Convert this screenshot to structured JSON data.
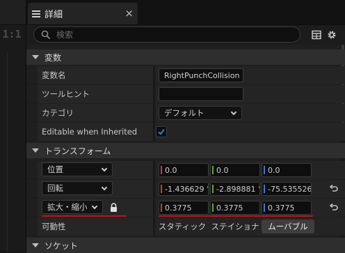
{
  "viewport": {
    "ratio_label": "1:1"
  },
  "tab": {
    "title": "詳細",
    "close": "×"
  },
  "search": {
    "placeholder": "検索"
  },
  "sections": {
    "variable": {
      "title": "変数"
    },
    "transform": {
      "title": "トランスフォーム"
    },
    "socket": {
      "title": "ソケット"
    }
  },
  "variable": {
    "name_label": "変数名",
    "name_value": "RightPunchCollision",
    "tooltip_label": "ツールヒント",
    "tooltip_value": "",
    "category_label": "カテゴリ",
    "category_value": "デフォルト",
    "editable_label": "Editable when Inherited",
    "editable_checked": true
  },
  "transform": {
    "location": {
      "label": "位置",
      "x": "0.0",
      "y": "0.0",
      "z": "0.0"
    },
    "rotation": {
      "label": "回転",
      "x": "-1.436629 °",
      "y": "-2.898881 °",
      "z": "-75.535526"
    },
    "scale": {
      "label": "拡大・縮小",
      "x": "0.3775",
      "y": "0.3775",
      "z": "0.3775",
      "locked": true
    },
    "mobility": {
      "label": "可動性",
      "options": [
        "スタティック",
        "ステイショナ",
        "ムーバブル"
      ],
      "selected": "ムーバブル"
    }
  },
  "colors": {
    "x_axis": "#c83c3c",
    "y_axis": "#5fa83c",
    "z_axis": "#3c78d8",
    "accent_check": "#2f7fe0",
    "annotation_red": "#c8101a"
  }
}
